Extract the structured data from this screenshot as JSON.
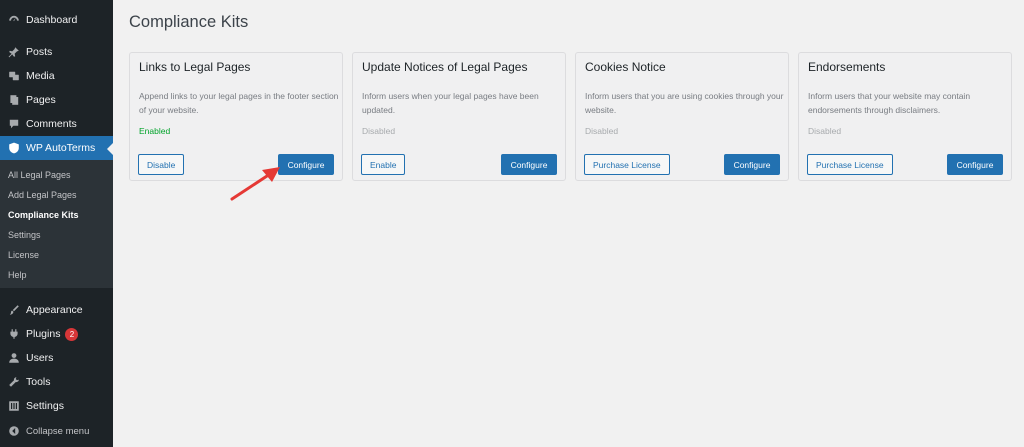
{
  "sidebar": {
    "items": [
      {
        "label": "Dashboard",
        "icon": "dashboard-icon"
      },
      {
        "label": "Posts",
        "icon": "pin-icon"
      },
      {
        "label": "Media",
        "icon": "media-icon"
      },
      {
        "label": "Pages",
        "icon": "pages-icon"
      },
      {
        "label": "Comments",
        "icon": "comment-icon"
      },
      {
        "label": "WP AutoTerms",
        "icon": "shield-icon"
      },
      {
        "label": "Appearance",
        "icon": "brush-icon"
      },
      {
        "label": "Plugins",
        "icon": "plug-icon",
        "badge": "2"
      },
      {
        "label": "Users",
        "icon": "user-icon"
      },
      {
        "label": "Tools",
        "icon": "wrench-icon"
      },
      {
        "label": "Settings",
        "icon": "sliders-icon"
      },
      {
        "label": "Collapse menu",
        "icon": "collapse-icon"
      }
    ],
    "submenu": [
      "All Legal Pages",
      "Add Legal Pages",
      "Compliance Kits",
      "Settings",
      "License",
      "Help"
    ]
  },
  "main": {
    "title": "Compliance Kits",
    "cards": [
      {
        "title": "Links to Legal Pages",
        "description": "Append links to your legal pages in the footer section of your website.",
        "status": "Enabled",
        "secondary_label": "Disable",
        "primary_label": "Configure"
      },
      {
        "title": "Update Notices of Legal Pages",
        "description": "Inform users when your legal pages have been updated.",
        "status": "Disabled",
        "secondary_label": "Enable",
        "primary_label": "Configure"
      },
      {
        "title": "Cookies Notice",
        "description": "Inform users that you are using cookies through your website.",
        "status": "Disabled",
        "secondary_label": "Purchase License",
        "primary_label": "Configure"
      },
      {
        "title": "Endorsements",
        "description": "Inform users that your website may contain endorsements through disclaimers.",
        "status": "Disabled",
        "secondary_label": "Purchase License",
        "primary_label": "Configure"
      }
    ]
  },
  "colors": {
    "sidebar_bg": "#1d2327",
    "accent": "#2271b1",
    "enabled": "#00a32a",
    "badge": "#d63638",
    "annotation": "#e53935"
  }
}
